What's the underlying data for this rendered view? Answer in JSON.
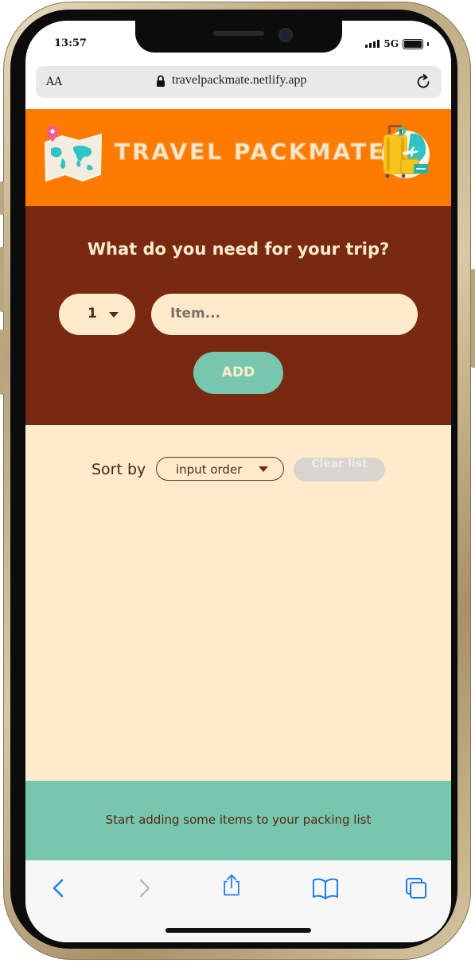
{
  "status": {
    "time": "13:57",
    "network": "5G"
  },
  "browser": {
    "text_size_label": "AA",
    "url": "travelpackmate.netlify.app"
  },
  "header": {
    "title": "TRAVEL PACKMATE"
  },
  "form": {
    "question": "What do you need for your trip?",
    "quantity_value": "1",
    "item_placeholder": "Item...",
    "add_label": "ADD"
  },
  "list": {
    "sort_label": "Sort by",
    "sort_value": "input order",
    "clear_label": "Clear list"
  },
  "footer": {
    "message": "Start adding some items to your packing list"
  },
  "colors": {
    "header_bg": "#ff7b00",
    "form_bg": "#7a2911",
    "list_bg": "#ffebcc",
    "footer_bg": "#76c7ae",
    "ios_blue": "#1a7cf5"
  }
}
